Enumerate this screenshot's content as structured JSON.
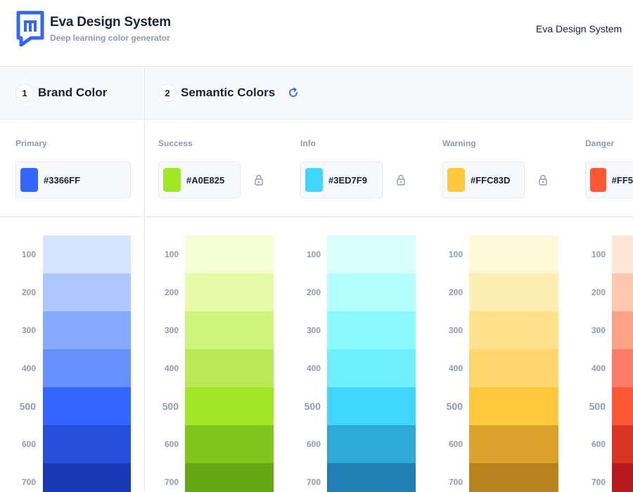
{
  "header": {
    "title": "Eva Design System",
    "subtitle": "Deep learning color generator",
    "link": "Eva Design System",
    "logo_color": "#3366FF"
  },
  "steps": [
    {
      "number": "1",
      "label": "Brand Color"
    },
    {
      "number": "2",
      "label": "Semantic Colors",
      "icon": "refresh-icon"
    }
  ],
  "colors": [
    {
      "name": "Primary",
      "hex": "#3366FF",
      "swatch": "#3366FF",
      "locked": false,
      "shades": [
        "#D6E4FF",
        "#ADC8FF",
        "#84A9FF",
        "#6690FF",
        "#3366FF",
        "#254EDB",
        "#1939B7"
      ]
    },
    {
      "name": "Success",
      "hex": "#A0E825",
      "swatch": "#A0E825",
      "locked": true,
      "shades": [
        "#F4FDD3",
        "#E5FBA8",
        "#CFF47B",
        "#B9E959",
        "#A0E825",
        "#81C71B",
        "#64A712"
      ]
    },
    {
      "name": "Info",
      "hex": "#3ED7F9",
      "swatch": "#3ED7F9",
      "locked": true,
      "shades": [
        "#D8FFFC",
        "#B1FFFE",
        "#8BFAFE",
        "#6EF0FD",
        "#3ED7F9",
        "#2DA9D6",
        "#1F80B3"
      ]
    },
    {
      "name": "Warning",
      "hex": "#FFC83D",
      "swatch": "#FFC83D",
      "locked": true,
      "shades": [
        "#FFF8D8",
        "#FFEEB1",
        "#FFE28A",
        "#FFD66D",
        "#FFC83D",
        "#DBA32C",
        "#B7811E"
      ]
    },
    {
      "name": "Danger",
      "hex": "#FF5",
      "swatch": "#FF5733",
      "locked": false,
      "shades": [
        "#FFE6D6",
        "#FFC7AD",
        "#FFA184",
        "#FF7D66",
        "#FF5733",
        "#DB3525",
        "#B7191C"
      ]
    }
  ],
  "shade_levels": [
    "100",
    "200",
    "300",
    "400",
    "500",
    "600",
    "700"
  ]
}
